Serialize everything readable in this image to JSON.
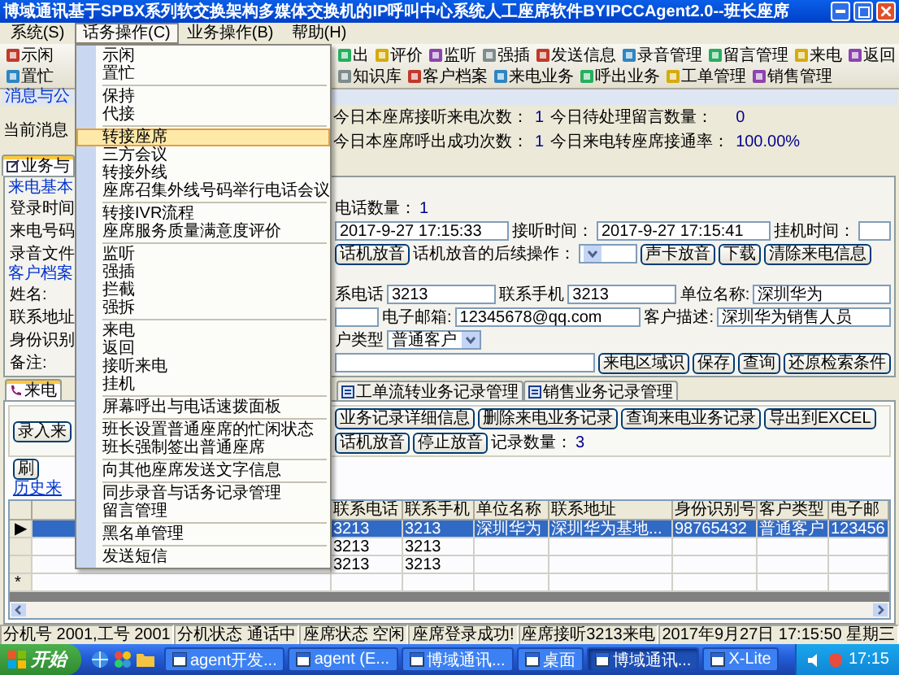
{
  "window": {
    "title": "博域通讯基于SPBX系列软交换架构多媒体交换机的IP呼叫中心系统人工座席软件BYIPCCAgent2.0--班长座席"
  },
  "menu_bar": [
    {
      "label": "系统(S)",
      "selected": false
    },
    {
      "label": "话务操作(C)",
      "selected": true
    },
    {
      "label": "业务操作(B)",
      "selected": false
    },
    {
      "label": "帮助(H)",
      "selected": false
    }
  ],
  "dropdown_menu": {
    "groups": [
      {
        "items": [
          {
            "label": "示闲",
            "selected": false
          },
          {
            "label": "置忙",
            "selected": false
          }
        ]
      },
      {
        "items": [
          {
            "label": "保持",
            "selected": false
          },
          {
            "label": "代接",
            "selected": false
          }
        ]
      },
      {
        "items": [
          {
            "label": "转接座席",
            "selected": true
          },
          {
            "label": "三方会议",
            "selected": false
          },
          {
            "label": "转接外线",
            "selected": false
          },
          {
            "label": "座席召集外线号码举行电话会议",
            "selected": false
          }
        ]
      },
      {
        "items": [
          {
            "label": "转接IVR流程",
            "selected": false
          },
          {
            "label": "座席服务质量满意度评价",
            "selected": false
          }
        ]
      },
      {
        "items": [
          {
            "label": "监听",
            "selected": false
          },
          {
            "label": "强插",
            "selected": false
          },
          {
            "label": "拦截",
            "selected": false
          },
          {
            "label": "强拆",
            "selected": false
          }
        ]
      },
      {
        "items": [
          {
            "label": "来电",
            "selected": false
          },
          {
            "label": "返回",
            "selected": false
          },
          {
            "label": "接听来电",
            "selected": false
          },
          {
            "label": "挂机",
            "selected": false
          }
        ]
      },
      {
        "items": [
          {
            "label": "屏幕呼出与电话速拨面板",
            "selected": false
          }
        ]
      },
      {
        "items": [
          {
            "label": "班长设置普通座席的忙闲状态",
            "selected": false
          },
          {
            "label": "班长强制签出普通座席",
            "selected": false
          }
        ]
      },
      {
        "items": [
          {
            "label": "向其他座席发送文字信息",
            "selected": false
          }
        ]
      },
      {
        "items": [
          {
            "label": "同步录音与话务记录管理",
            "selected": false
          },
          {
            "label": "留言管理",
            "selected": false
          }
        ]
      },
      {
        "items": [
          {
            "label": "黑名单管理",
            "selected": false
          }
        ]
      },
      {
        "items": [
          {
            "label": "发送短信",
            "selected": false
          }
        ]
      }
    ]
  },
  "toolbar": {
    "left": [
      "示闲",
      "置忙"
    ],
    "right": [
      "出",
      "评价",
      "监听",
      "强插",
      "发送信息",
      "录音管理",
      "留言管理",
      "来电",
      "返回",
      "知识库",
      "客户档案",
      "来电业务",
      "呼出业务",
      "工单管理",
      "销售管理"
    ]
  },
  "message_panel": {
    "title": "消息与公",
    "label": "当前消息",
    "stats": [
      {
        "label": "今日本座席接听来电次数：",
        "value": "1"
      },
      {
        "label": "今日待处理留言数量：",
        "value": "0"
      },
      {
        "label": "今日本座席呼出成功次数：",
        "value": "1"
      },
      {
        "label": "今日来电转座席接通率：",
        "value": "100.00%"
      }
    ]
  },
  "main_tab": {
    "label": "业务与",
    "selected": true
  },
  "call_form": {
    "sections": [
      {
        "title": "来电基本",
        "rows": [
          {
            "label": "登录时间",
            "items": [
              {
                "kind": "label",
                "text": "电话数量："
              },
              {
                "kind": "value",
                "text": "1"
              }
            ]
          },
          {
            "label": "来电号码",
            "items": [
              {
                "kind": "field",
                "text": "2017-9-27 17:15:33"
              },
              {
                "kind": "label",
                "text": "接听时间："
              },
              {
                "kind": "field",
                "text": "2017-9-27 17:15:41"
              },
              {
                "kind": "label",
                "text": "挂机时间："
              },
              {
                "kind": "field"
              }
            ]
          },
          {
            "label": "录音文件",
            "items": [
              {
                "kind": "button",
                "text": "话机放音"
              },
              {
                "kind": "label",
                "text": "话机放音的后续操作："
              },
              {
                "kind": "select"
              },
              {
                "kind": "button",
                "text": "声卡放音"
              },
              {
                "kind": "button",
                "text": "下载"
              },
              {
                "kind": "button",
                "text": "清除来电信息"
              }
            ]
          }
        ]
      },
      {
        "title": "客户档案",
        "rows": [
          {
            "label": "姓名:",
            "items": [
              {
                "kind": "label",
                "text": "系电话"
              },
              {
                "kind": "field",
                "text": "3213"
              },
              {
                "kind": "label",
                "text": "联系手机"
              },
              {
                "kind": "field",
                "text": "3213"
              },
              {
                "kind": "label",
                "text": "单位名称:"
              },
              {
                "kind": "field",
                "text": "深圳华为"
              }
            ]
          },
          {
            "label": "联系地址",
            "items": [
              {
                "kind": "field"
              },
              {
                "kind": "label",
                "text": "电子邮箱:"
              },
              {
                "kind": "field",
                "text": "12345678@qq.com"
              },
              {
                "kind": "label",
                "text": "客户描述:"
              },
              {
                "kind": "field",
                "text": "深圳华为销售人员"
              }
            ]
          },
          {
            "label": "身份识别",
            "items": [
              {
                "kind": "label",
                "text": "户类型"
              },
              {
                "kind": "select",
                "text": "普通客户"
              }
            ]
          },
          {
            "label": "备注:",
            "items": [
              {
                "kind": "field"
              },
              {
                "kind": "button",
                "text": "来电区域识"
              },
              {
                "kind": "button",
                "text": "保存"
              },
              {
                "kind": "button",
                "text": "查询"
              },
              {
                "kind": "button",
                "text": "还原检索条件"
              }
            ]
          }
        ]
      }
    ]
  },
  "record_tabs": {
    "left": [
      {
        "label": "来电",
        "selected": true
      }
    ],
    "right": [
      {
        "label": "工单流转业务记录管理",
        "selected": false
      },
      {
        "label": "销售业务记录管理",
        "selected": false
      }
    ]
  },
  "record_toolbar": {
    "left": [
      {
        "kind": "button",
        "text": "录入来"
      }
    ],
    "right": [
      {
        "kind": "button",
        "text": "业务记录详细信息"
      },
      {
        "kind": "button",
        "text": "删除来电业务记录"
      },
      {
        "kind": "button",
        "text": "查询来电业务记录"
      },
      {
        "kind": "button",
        "text": "导出到EXCEL"
      },
      {
        "kind": "button",
        "text": "话机放音"
      },
      {
        "kind": "button",
        "text": "停止放音"
      },
      {
        "kind": "label",
        "text": "记录数量："
      },
      {
        "kind": "value",
        "text": "3"
      }
    ]
  },
  "refresh_button": "刷",
  "history_link": "历史来",
  "table": {
    "columns": [
      "联系电话",
      "联系手机",
      "单位名称",
      "联系地址",
      "身份识别号",
      "客户类型",
      "电子邮"
    ],
    "rows": [
      {
        "marker": "▶",
        "selected": true,
        "cells": [
          "3213",
          "3213",
          "深圳华为",
          "深圳华为基地...",
          "98765432",
          "普通客户",
          "123456"
        ]
      },
      {
        "selected": false,
        "cells": [
          "3213",
          "3213"
        ]
      },
      {
        "selected": false,
        "cells": [
          "3213",
          "3213"
        ]
      },
      {
        "marker": "*",
        "selected": false
      }
    ]
  },
  "status_bar": [
    "分机号 2001,工号 2001",
    "分机状态 通话中",
    "座席状态 空闲",
    "座席登录成功!",
    "座席接听3213来电",
    "2017年9月27日 17:15:50 星期三"
  ],
  "taskbar": {
    "start": "开始",
    "buttons": [
      {
        "label": "agent开发...",
        "selected": false
      },
      {
        "label": "agent (E...",
        "selected": false
      },
      {
        "label": "博域通讯...",
        "selected": false
      },
      {
        "label": "桌面",
        "selected": false
      },
      {
        "label": "博域通讯...",
        "selected": true
      },
      {
        "label": "X-Lite",
        "selected": false
      }
    ],
    "clock": "17:15"
  }
}
